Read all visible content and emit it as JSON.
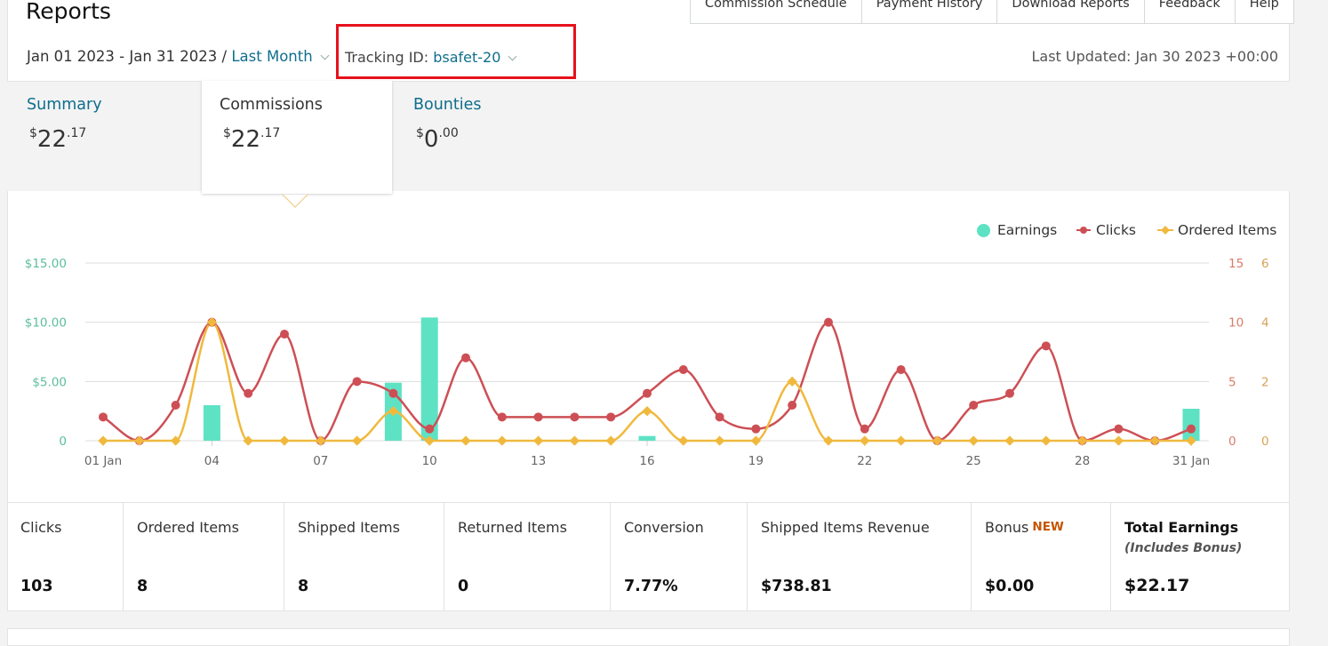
{
  "header": {
    "title": "Reports",
    "nav": [
      "Commission Schedule",
      "Payment History",
      "Download Reports",
      "Feedback",
      "Help"
    ],
    "date_range": "Jan 01 2023 - Jan 31 2023",
    "separator": "/",
    "period": "Last Month",
    "tracking_label": "Tracking ID:",
    "tracking_id": "bsafet-20",
    "last_updated": "Last Updated: Jan 30 2023 +00:00"
  },
  "tabs": [
    {
      "label": "Summary",
      "dollar": "$",
      "whole": "22",
      "cents": ".17"
    },
    {
      "label": "Commissions",
      "dollar": "$",
      "whole": "22",
      "cents": ".17"
    },
    {
      "label": "Bounties",
      "dollar": "$",
      "whole": "0",
      "cents": ".00"
    }
  ],
  "legend": {
    "earnings": "Earnings",
    "clicks": "Clicks",
    "ordered": "Ordered Items"
  },
  "colors": {
    "earnings": "#5ee2c4",
    "clicks": "#cd4f55",
    "ordered": "#f0b93e",
    "link": "#0f6e8c",
    "highlight": "#e6111b"
  },
  "chart_data": {
    "type": "bar",
    "x": [
      "01 Jan",
      "02",
      "03",
      "04",
      "05",
      "06",
      "07",
      "08",
      "09",
      "10",
      "11",
      "12",
      "13",
      "14",
      "15",
      "16",
      "17",
      "18",
      "19",
      "20",
      "21",
      "22",
      "23",
      "24",
      "25",
      "26",
      "27",
      "28",
      "29",
      "30",
      "31 Jan"
    ],
    "x_tick_labels": [
      "01 Jan",
      "04",
      "07",
      "10",
      "13",
      "16",
      "19",
      "22",
      "25",
      "28",
      "31 Jan"
    ],
    "series": [
      {
        "name": "Earnings",
        "kind": "bar",
        "axis": "left",
        "values": [
          0,
          0,
          0,
          3.0,
          0,
          0,
          0,
          0,
          4.9,
          10.4,
          0,
          0,
          0,
          0,
          0,
          0.4,
          0,
          0,
          0,
          0,
          0,
          0,
          0,
          0,
          0,
          0,
          0,
          0,
          0,
          0,
          2.7
        ]
      },
      {
        "name": "Clicks",
        "kind": "line",
        "axis": "right1",
        "values": [
          2,
          0,
          3,
          10,
          4,
          9,
          0,
          5,
          4,
          1,
          7,
          2,
          2,
          2,
          2,
          4,
          6,
          2,
          1,
          3,
          10,
          1,
          6,
          0,
          3,
          4,
          8,
          0,
          1,
          0,
          1
        ]
      },
      {
        "name": "Ordered Items",
        "kind": "line",
        "axis": "right2",
        "values": [
          0,
          0,
          0,
          4,
          0,
          0,
          0,
          0,
          1,
          0,
          0,
          0,
          0,
          0,
          0,
          1,
          0,
          0,
          0,
          2,
          0,
          0,
          0,
          0,
          0,
          0,
          0,
          0,
          0,
          0,
          0
        ]
      }
    ],
    "y_left": {
      "ticks": [
        "0",
        "$5.00",
        "$10.00",
        "$15.00"
      ],
      "range": [
        0,
        15
      ]
    },
    "y_right1": {
      "ticks": [
        "0",
        "5",
        "10",
        "15"
      ],
      "range": [
        0,
        15
      ]
    },
    "y_right2": {
      "ticks": [
        "0",
        "2",
        "4",
        "6"
      ],
      "range": [
        0,
        6
      ]
    },
    "legend_position": "top-right",
    "grid": true
  },
  "stats": [
    {
      "label": "Clicks",
      "value": "103"
    },
    {
      "label": "Ordered Items",
      "value": "8"
    },
    {
      "label": "Shipped Items",
      "value": "8"
    },
    {
      "label": "Returned Items",
      "value": "0"
    },
    {
      "label": "Conversion",
      "value": "7.77%"
    },
    {
      "label": "Shipped Items Revenue",
      "value": "$738.81"
    },
    {
      "label": "Bonus",
      "badge": "NEW",
      "value": "$0.00"
    },
    {
      "label": "Total Earnings",
      "sublabel": "(Includes Bonus)",
      "value": "$22.17"
    }
  ]
}
